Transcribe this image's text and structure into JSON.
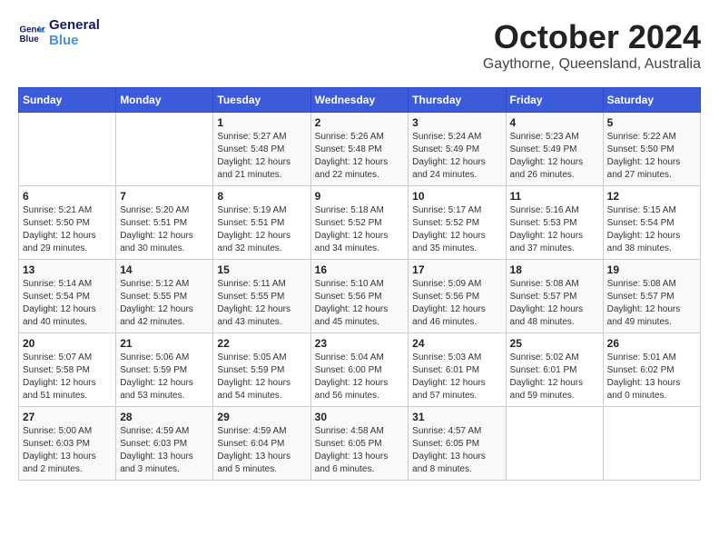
{
  "header": {
    "logo_line1": "General",
    "logo_line2": "Blue",
    "month": "October 2024",
    "location": "Gaythorne, Queensland, Australia"
  },
  "weekdays": [
    "Sunday",
    "Monday",
    "Tuesday",
    "Wednesday",
    "Thursday",
    "Friday",
    "Saturday"
  ],
  "weeks": [
    [
      {
        "day": "",
        "info": ""
      },
      {
        "day": "",
        "info": ""
      },
      {
        "day": "1",
        "info": "Sunrise: 5:27 AM\nSunset: 5:48 PM\nDaylight: 12 hours and 21 minutes."
      },
      {
        "day": "2",
        "info": "Sunrise: 5:26 AM\nSunset: 5:48 PM\nDaylight: 12 hours and 22 minutes."
      },
      {
        "day": "3",
        "info": "Sunrise: 5:24 AM\nSunset: 5:49 PM\nDaylight: 12 hours and 24 minutes."
      },
      {
        "day": "4",
        "info": "Sunrise: 5:23 AM\nSunset: 5:49 PM\nDaylight: 12 hours and 26 minutes."
      },
      {
        "day": "5",
        "info": "Sunrise: 5:22 AM\nSunset: 5:50 PM\nDaylight: 12 hours and 27 minutes."
      }
    ],
    [
      {
        "day": "6",
        "info": "Sunrise: 5:21 AM\nSunset: 5:50 PM\nDaylight: 12 hours and 29 minutes."
      },
      {
        "day": "7",
        "info": "Sunrise: 5:20 AM\nSunset: 5:51 PM\nDaylight: 12 hours and 30 minutes."
      },
      {
        "day": "8",
        "info": "Sunrise: 5:19 AM\nSunset: 5:51 PM\nDaylight: 12 hours and 32 minutes."
      },
      {
        "day": "9",
        "info": "Sunrise: 5:18 AM\nSunset: 5:52 PM\nDaylight: 12 hours and 34 minutes."
      },
      {
        "day": "10",
        "info": "Sunrise: 5:17 AM\nSunset: 5:52 PM\nDaylight: 12 hours and 35 minutes."
      },
      {
        "day": "11",
        "info": "Sunrise: 5:16 AM\nSunset: 5:53 PM\nDaylight: 12 hours and 37 minutes."
      },
      {
        "day": "12",
        "info": "Sunrise: 5:15 AM\nSunset: 5:54 PM\nDaylight: 12 hours and 38 minutes."
      }
    ],
    [
      {
        "day": "13",
        "info": "Sunrise: 5:14 AM\nSunset: 5:54 PM\nDaylight: 12 hours and 40 minutes."
      },
      {
        "day": "14",
        "info": "Sunrise: 5:12 AM\nSunset: 5:55 PM\nDaylight: 12 hours and 42 minutes."
      },
      {
        "day": "15",
        "info": "Sunrise: 5:11 AM\nSunset: 5:55 PM\nDaylight: 12 hours and 43 minutes."
      },
      {
        "day": "16",
        "info": "Sunrise: 5:10 AM\nSunset: 5:56 PM\nDaylight: 12 hours and 45 minutes."
      },
      {
        "day": "17",
        "info": "Sunrise: 5:09 AM\nSunset: 5:56 PM\nDaylight: 12 hours and 46 minutes."
      },
      {
        "day": "18",
        "info": "Sunrise: 5:08 AM\nSunset: 5:57 PM\nDaylight: 12 hours and 48 minutes."
      },
      {
        "day": "19",
        "info": "Sunrise: 5:08 AM\nSunset: 5:57 PM\nDaylight: 12 hours and 49 minutes."
      }
    ],
    [
      {
        "day": "20",
        "info": "Sunrise: 5:07 AM\nSunset: 5:58 PM\nDaylight: 12 hours and 51 minutes."
      },
      {
        "day": "21",
        "info": "Sunrise: 5:06 AM\nSunset: 5:59 PM\nDaylight: 12 hours and 53 minutes."
      },
      {
        "day": "22",
        "info": "Sunrise: 5:05 AM\nSunset: 5:59 PM\nDaylight: 12 hours and 54 minutes."
      },
      {
        "day": "23",
        "info": "Sunrise: 5:04 AM\nSunset: 6:00 PM\nDaylight: 12 hours and 56 minutes."
      },
      {
        "day": "24",
        "info": "Sunrise: 5:03 AM\nSunset: 6:01 PM\nDaylight: 12 hours and 57 minutes."
      },
      {
        "day": "25",
        "info": "Sunrise: 5:02 AM\nSunset: 6:01 PM\nDaylight: 12 hours and 59 minutes."
      },
      {
        "day": "26",
        "info": "Sunrise: 5:01 AM\nSunset: 6:02 PM\nDaylight: 13 hours and 0 minutes."
      }
    ],
    [
      {
        "day": "27",
        "info": "Sunrise: 5:00 AM\nSunset: 6:03 PM\nDaylight: 13 hours and 2 minutes."
      },
      {
        "day": "28",
        "info": "Sunrise: 4:59 AM\nSunset: 6:03 PM\nDaylight: 13 hours and 3 minutes."
      },
      {
        "day": "29",
        "info": "Sunrise: 4:59 AM\nSunset: 6:04 PM\nDaylight: 13 hours and 5 minutes."
      },
      {
        "day": "30",
        "info": "Sunrise: 4:58 AM\nSunset: 6:05 PM\nDaylight: 13 hours and 6 minutes."
      },
      {
        "day": "31",
        "info": "Sunrise: 4:57 AM\nSunset: 6:05 PM\nDaylight: 13 hours and 8 minutes."
      },
      {
        "day": "",
        "info": ""
      },
      {
        "day": "",
        "info": ""
      }
    ]
  ]
}
